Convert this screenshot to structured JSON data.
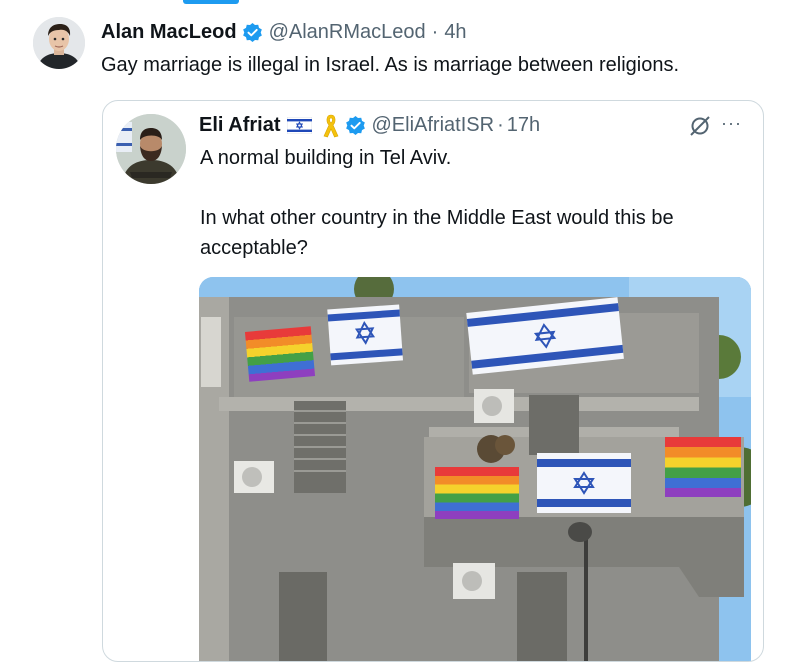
{
  "tweet": {
    "author_name": "Alan MacLeod",
    "handle": "@AlanRMacLeod",
    "separator": "·",
    "time": "4h",
    "text": "Gay marriage is illegal in Israel. As is marriage between religions.",
    "verified_icon": "verified-badge-icon",
    "accent_color": "#1d9bf0"
  },
  "quoted_tweet": {
    "author_name": "Eli Afriat",
    "handle": "@EliAfriatISR",
    "separator": "·",
    "time": "17h",
    "text_line1": "A normal building in Tel Aviv.",
    "text_line2": "In what other country in the Middle East would this be acceptable?",
    "icons": [
      "israel-flag-emoji",
      "yellow-ribbon-emoji",
      "verified-badge-icon",
      "grok-icon",
      "more-icon"
    ],
    "more_label": "···",
    "photo_description_icon": "photo"
  }
}
